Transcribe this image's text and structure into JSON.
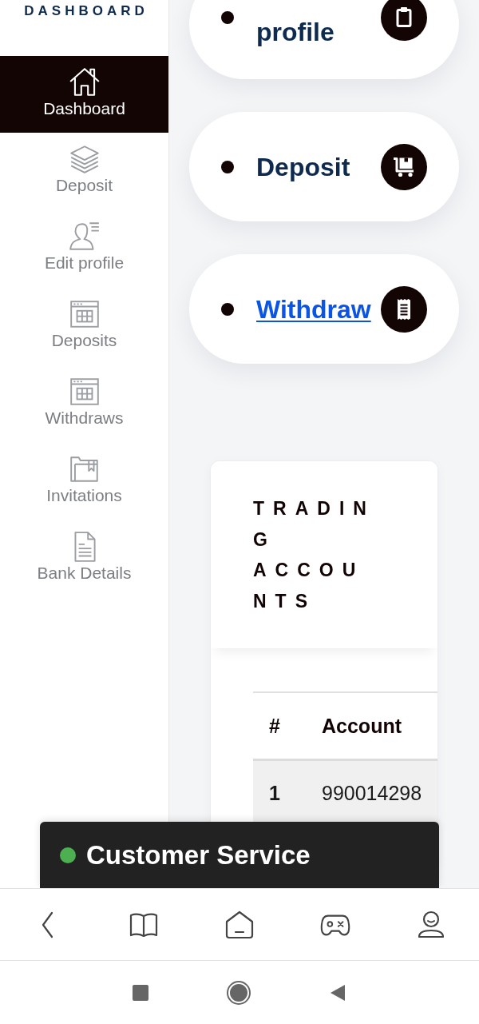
{
  "sidebar": {
    "brand": "DASHBOARD",
    "items": [
      {
        "label": "Dashboard",
        "selected": true
      },
      {
        "label": "Deposit",
        "selected": false
      },
      {
        "label": "Edit profile",
        "selected": false
      },
      {
        "label": "Deposits",
        "selected": false
      },
      {
        "label": "Withdraws",
        "selected": false
      },
      {
        "label": "Invitations",
        "selected": false
      },
      {
        "label": "Bank Details",
        "selected": false
      }
    ]
  },
  "shortcuts": [
    {
      "label": "profile",
      "kind": "text"
    },
    {
      "label": "Deposit",
      "kind": "text"
    },
    {
      "label": "Withdraw",
      "kind": "link"
    }
  ],
  "trading_accounts": {
    "title": "TRADING ACCOUNTS",
    "table": {
      "columns": [
        "#",
        "Account"
      ],
      "rows": [
        [
          "1",
          "990014298"
        ]
      ]
    }
  },
  "chat_widget": {
    "label": "Customer Service",
    "online": true
  }
}
